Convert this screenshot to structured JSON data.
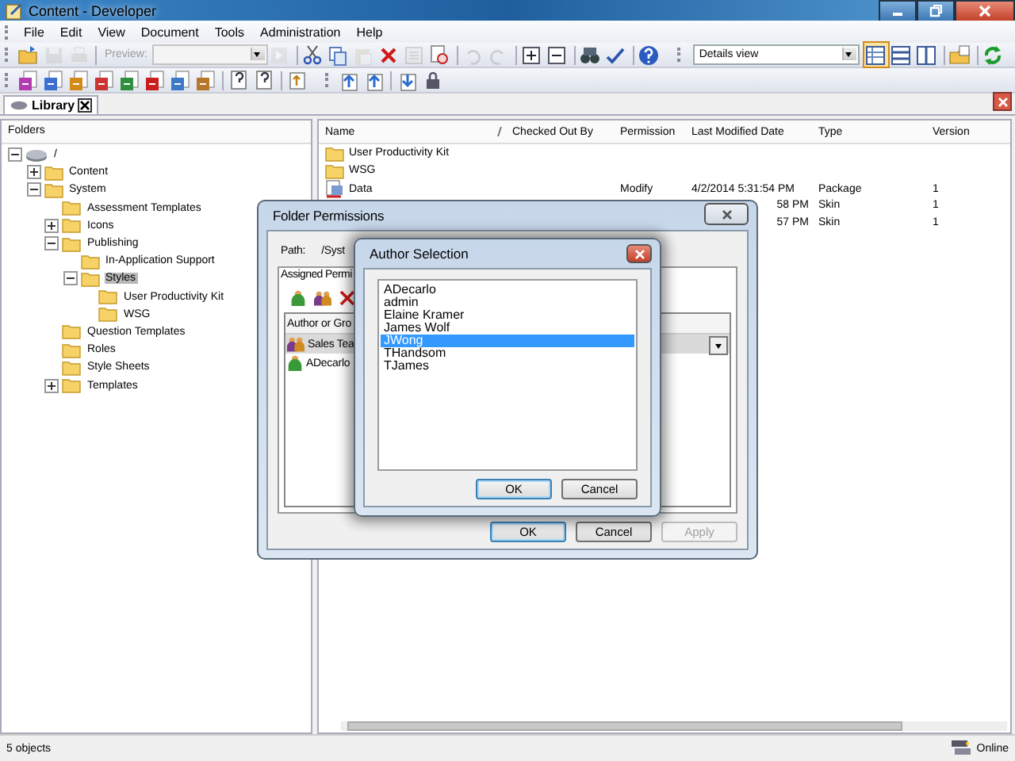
{
  "window": {
    "title": "Content - Developer"
  },
  "menu": [
    "File",
    "Edit",
    "View",
    "Document",
    "Tools",
    "Administration",
    "Help"
  ],
  "toolbar1": [
    {
      "kind": "open",
      "disabled": false
    },
    {
      "kind": "save",
      "disabled": true
    },
    {
      "kind": "print",
      "disabled": true
    },
    {
      "kind": "sep"
    },
    {
      "kind": "preview",
      "label": "Preview:",
      "disabled": true
    },
    {
      "kind": "combo",
      "disabled": true
    },
    {
      "kind": "go",
      "disabled": true
    },
    {
      "kind": "sep"
    },
    {
      "kind": "cut",
      "disabled": false
    },
    {
      "kind": "copy",
      "disabled": false
    },
    {
      "kind": "paste",
      "disabled": true
    },
    {
      "kind": "delete",
      "disabled": false
    },
    {
      "kind": "properties",
      "disabled": true
    },
    {
      "kind": "find",
      "disabled": false
    },
    {
      "kind": "sep"
    },
    {
      "kind": "undo",
      "disabled": true
    },
    {
      "kind": "redo",
      "disabled": true
    },
    {
      "kind": "sep"
    },
    {
      "kind": "expand",
      "disabled": false
    },
    {
      "kind": "collapse",
      "disabled": false
    },
    {
      "kind": "sep"
    },
    {
      "kind": "binoculars",
      "disabled": false
    },
    {
      "kind": "spellcheck",
      "disabled": false
    },
    {
      "kind": "sep"
    },
    {
      "kind": "help",
      "disabled": false
    },
    {
      "kind": "grip"
    },
    {
      "kind": "view-combo",
      "label": "Details view",
      "disabled": false
    },
    {
      "kind": "details-view",
      "selected": true
    },
    {
      "kind": "rows-view",
      "selected": false
    },
    {
      "kind": "columns-view",
      "selected": false
    },
    {
      "kind": "sep"
    },
    {
      "kind": "folder-properties",
      "disabled": false
    },
    {
      "kind": "sep"
    },
    {
      "kind": "refresh",
      "disabled": false
    }
  ],
  "toolbar2": [
    {
      "kind": "document",
      "disabled": false
    },
    {
      "kind": "document",
      "disabled": false
    },
    {
      "kind": "document",
      "disabled": false
    },
    {
      "kind": "document",
      "disabled": false
    },
    {
      "kind": "document",
      "disabled": false
    },
    {
      "kind": "document",
      "disabled": false
    },
    {
      "kind": "document",
      "disabled": false
    },
    {
      "kind": "document",
      "disabled": false
    },
    {
      "kind": "sep"
    },
    {
      "kind": "help-page",
      "disabled": false
    },
    {
      "kind": "help-menu",
      "disabled": false
    },
    {
      "kind": "sep"
    },
    {
      "kind": "publish",
      "disabled": false
    },
    {
      "kind": "grip"
    },
    {
      "kind": "upload",
      "disabled": false
    },
    {
      "kind": "upload",
      "disabled": false
    },
    {
      "kind": "sep"
    },
    {
      "kind": "download",
      "disabled": false
    },
    {
      "kind": "lock",
      "disabled": false
    }
  ],
  "tabs": [
    {
      "label": "Library",
      "selected": true
    }
  ],
  "folders": {
    "header": "Folders",
    "tree": [
      {
        "label": "/",
        "kind": "drive",
        "expanded": true,
        "selected": false,
        "children": [
          {
            "label": "Content",
            "kind": "folder",
            "expanded": false,
            "selected": false
          },
          {
            "label": "System",
            "kind": "folder",
            "expanded": true,
            "selected": false,
            "children": [
              {
                "label": "Assessment Templates",
                "kind": "folder",
                "selected": false
              },
              {
                "label": "Icons",
                "kind": "folder",
                "expanded": false,
                "selected": false
              },
              {
                "label": "Publishing",
                "kind": "folder",
                "expanded": true,
                "selected": false,
                "children": [
                  {
                    "label": "In-Application Support",
                    "kind": "folder",
                    "selected": false
                  },
                  {
                    "label": "Styles",
                    "kind": "folder",
                    "expanded": true,
                    "selected": true,
                    "children": [
                      {
                        "label": "User Productivity Kit",
                        "kind": "folder",
                        "selected": false
                      },
                      {
                        "label": "WSG",
                        "kind": "folder",
                        "selected": false
                      }
                    ]
                  }
                ]
              },
              {
                "label": "Question Templates",
                "kind": "folder",
                "selected": false
              },
              {
                "label": "Roles",
                "kind": "folder",
                "selected": false
              },
              {
                "label": "Style Sheets",
                "kind": "folder",
                "selected": false
              },
              {
                "label": "Templates",
                "kind": "folder",
                "expanded": false,
                "selected": false
              }
            ]
          }
        ]
      }
    ]
  },
  "list": {
    "columns": [
      {
        "label": "Name",
        "sorted": true
      },
      {
        "label": "Checked Out By",
        "sorted": false
      },
      {
        "label": "Permission",
        "sorted": false
      },
      {
        "label": "Last Modified Date",
        "sorted": false
      },
      {
        "label": "Type",
        "sorted": false
      },
      {
        "label": "Version",
        "sorted": false
      }
    ],
    "rows": [
      {
        "kind": "folder",
        "name": "User Productivity Kit"
      },
      {
        "kind": "folder",
        "name": "WSG"
      },
      {
        "kind": "package",
        "name": "Data",
        "permission": "Modify",
        "last_modified": "4/2/2014 5:31:54 PM",
        "type": "Package",
        "version": "1"
      },
      {
        "kind": "covered",
        "last_modified": "58 PM",
        "type": "Skin",
        "version": "1"
      },
      {
        "kind": "covered",
        "last_modified": "57 PM",
        "type": "Skin",
        "version": "1"
      }
    ]
  },
  "folder_permissions": {
    "title": "Folder Permissions",
    "path_label": "Path:",
    "path": "/Syst",
    "tab": "Assigned Permi",
    "list_header": "Author or Gro",
    "entries": [
      {
        "kind": "group",
        "name": "Sales Tea",
        "selected": true
      },
      {
        "kind": "user",
        "name": "ADecarlo",
        "selected": false
      }
    ],
    "buttons": [
      {
        "label": "OK",
        "disabled": false,
        "default": true
      },
      {
        "label": "Cancel",
        "disabled": false,
        "default": false
      },
      {
        "label": "Apply",
        "disabled": true,
        "default": false
      }
    ]
  },
  "author_selection": {
    "title": "Author Selection",
    "authors": [
      {
        "name": "ADecarlo",
        "selected": false
      },
      {
        "name": "admin",
        "selected": false
      },
      {
        "name": "Elaine Kramer",
        "selected": false
      },
      {
        "name": "James Wolf",
        "selected": false
      },
      {
        "name": "JWong",
        "selected": true
      },
      {
        "name": "THandsom",
        "selected": false
      },
      {
        "name": "TJames",
        "selected": false
      }
    ],
    "buttons": [
      {
        "label": "OK",
        "default": true
      },
      {
        "label": "Cancel",
        "default": false
      }
    ]
  },
  "status": {
    "text": "5 objects",
    "connection": "Online"
  }
}
